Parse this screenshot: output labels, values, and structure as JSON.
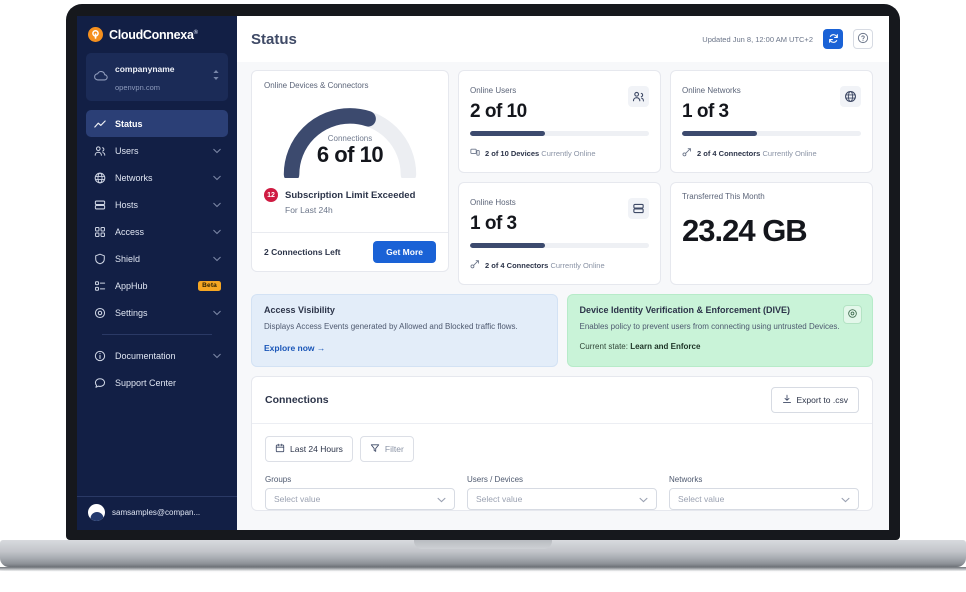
{
  "sidebar": {
    "brand": {
      "name": "CloudConnexa",
      "trademark": "®",
      "logo_color": "#f5901e"
    },
    "org": {
      "name": "companyname",
      "domain": "openvpn.com"
    },
    "items": [
      {
        "label": "Status",
        "icon": "status-icon",
        "chevron": false,
        "active": true
      },
      {
        "label": "Users",
        "icon": "users-icon",
        "chevron": true,
        "active": false
      },
      {
        "label": "Networks",
        "icon": "globe-icon",
        "chevron": true,
        "active": false
      },
      {
        "label": "Hosts",
        "icon": "server-icon",
        "chevron": true,
        "active": false
      },
      {
        "label": "Access",
        "icon": "grid-icon",
        "chevron": true,
        "active": false
      },
      {
        "label": "Shield",
        "icon": "shield-icon",
        "chevron": true,
        "active": false
      },
      {
        "label": "AppHub",
        "icon": "apphub-icon",
        "chevron": false,
        "active": false,
        "badge": "Beta"
      },
      {
        "label": "Settings",
        "icon": "gear-icon",
        "chevron": true,
        "active": false
      }
    ],
    "secondary_items": [
      {
        "label": "Documentation",
        "icon": "info-icon",
        "chevron": true
      },
      {
        "label": "Support Center",
        "icon": "comment-icon",
        "chevron": false
      }
    ],
    "user": {
      "email": "samsamples@compan..."
    }
  },
  "header": {
    "title": "Status",
    "updated": "Updated Jun 8, 12:00 AM UTC+2",
    "refresh_icon": "refresh-icon",
    "help_icon": "question-mark-icon",
    "accent_color": "#1a62d6"
  },
  "gauge_card": {
    "label": "Online Devices & Connectors",
    "caption": "Connections",
    "value": "6 of 10",
    "percent": 60,
    "alert_count": "12",
    "alert_title": "Subscription Limit Exceeded",
    "alert_sub": "For Last 24h",
    "footer_text": "2 Connections Left",
    "footer_button": "Get More",
    "arc_color": "#3c4a6e",
    "track_color": "#eceef2",
    "alert_color": "#cf1b42"
  },
  "stat_cards": [
    {
      "label": "Online Users",
      "value": "2 of 10",
      "icon": "users-icon",
      "percent": 42,
      "foot_icon": "devices-icon",
      "foot_bold": "2 of 10 Devices",
      "foot_rest": "Currently Online"
    },
    {
      "label": "Online Networks",
      "value": "1 of 3",
      "icon": "globe-icon",
      "percent": 42,
      "foot_icon": "connector-icon",
      "foot_bold": "2 of 4 Connectors",
      "foot_rest": "Currently Online"
    },
    {
      "label": "Online Hosts",
      "value": "1 of 3",
      "icon": "server-icon",
      "percent": 42,
      "foot_icon": "connector-icon",
      "foot_bold": "2 of 4 Connectors",
      "foot_rest": "Currently Online"
    }
  ],
  "transfer_card": {
    "label": "Transferred This Month",
    "value": "23.24 GB"
  },
  "banners": [
    {
      "title": "Access Visibility",
      "desc": "Displays Access Events generated by Allowed and Blocked traffic flows.",
      "link": "Explore now",
      "link_icon": "arrow-right-icon",
      "bg": "#e3edf9"
    },
    {
      "title": "Device Identity Verification & Enforcement (DIVE)",
      "desc": "Enables policy to prevent users from connecting using untrusted Devices.",
      "state_label": "Current state:",
      "state_value": "Learn and Enforce",
      "gear_icon": "gear-icon",
      "bg": "#c9f3d8"
    }
  ],
  "connections": {
    "title": "Connections",
    "export_label": "Export to .csv",
    "export_icon": "download-icon",
    "date_button": {
      "label": "Last 24 Hours",
      "icon": "calendar-icon"
    },
    "filter_button": {
      "label": "Filter",
      "icon": "filter-icon"
    },
    "filters": [
      {
        "label": "Groups",
        "placeholder": "Select value"
      },
      {
        "label": "Users / Devices",
        "placeholder": "Select value"
      },
      {
        "label": "Networks",
        "placeholder": "Select value"
      }
    ]
  }
}
